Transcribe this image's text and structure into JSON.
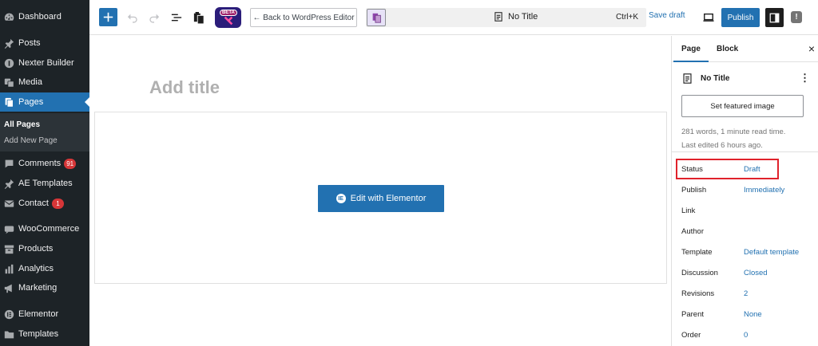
{
  "sidebar": {
    "items": [
      {
        "label": "Dashboard",
        "icon": "dashboard-icon"
      },
      {
        "label": "Posts",
        "icon": "pin-icon"
      },
      {
        "label": "Nexter Builder",
        "icon": "nexter-icon"
      },
      {
        "label": "Media",
        "icon": "media-icon"
      },
      {
        "label": "Pages",
        "icon": "pages-icon"
      },
      {
        "label": "Comments",
        "icon": "comments-icon",
        "badge": "91"
      },
      {
        "label": "AE Templates",
        "icon": "pin-icon"
      },
      {
        "label": "Contact",
        "icon": "mail-icon",
        "badge": "1"
      },
      {
        "label": "WooCommerce",
        "icon": "woo-icon"
      },
      {
        "label": "Products",
        "icon": "archive-icon"
      },
      {
        "label": "Analytics",
        "icon": "chart-icon"
      },
      {
        "label": "Marketing",
        "icon": "megaphone-icon"
      },
      {
        "label": "Elementor",
        "icon": "elementor-icon"
      },
      {
        "label": "Templates",
        "icon": "folder-icon"
      }
    ],
    "submenu": {
      "all_pages": "All Pages",
      "add_new": "Add New Page"
    }
  },
  "toolbar": {
    "back_label": "← Back to WordPress Editor",
    "beta_label": "BETA",
    "doc_title": "No Title",
    "shortcut": "Ctrl+K",
    "save_draft": "Save draft",
    "publish": "Publish",
    "options": "!"
  },
  "canvas": {
    "title_placeholder": "Add title",
    "edit_elementor": "Edit with Elementor",
    "elementor_icon_text": "IE"
  },
  "panel": {
    "tabs": {
      "page": "Page",
      "block": "Block"
    },
    "close": "×",
    "doc_title": "No Title",
    "featured_image": "Set featured image",
    "word_count": "281 words, 1 minute read time.",
    "last_edited": "Last edited 6 hours ago.",
    "rows": [
      {
        "label": "Status",
        "value": "Draft"
      },
      {
        "label": "Publish",
        "value": "Immediately"
      },
      {
        "label": "Link",
        "value": ""
      },
      {
        "label": "Author",
        "value": ""
      },
      {
        "label": "Template",
        "value": "Default template"
      },
      {
        "label": "Discussion",
        "value": "Closed"
      },
      {
        "label": "Revisions",
        "value": "2"
      },
      {
        "label": "Parent",
        "value": "None"
      },
      {
        "label": "Order",
        "value": "0"
      }
    ]
  },
  "colors": {
    "accent": "#2271b1",
    "sidebar": "#1d2327",
    "highlight": "#e0222b",
    "badge": "#d63638"
  }
}
